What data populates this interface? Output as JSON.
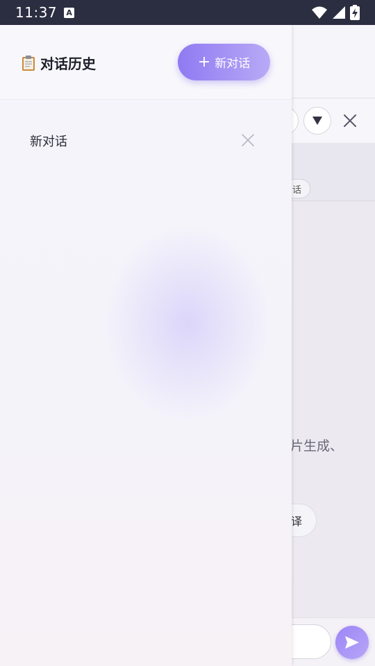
{
  "status_bar": {
    "time": "11:37",
    "notification_icon": "a-icon",
    "wifi_icon": "wifi-icon",
    "signal_icon": "signal-icon",
    "battery_icon": "battery-charging-icon"
  },
  "drawer": {
    "title_icon": "clipboard-icon",
    "title": "对话历史",
    "new_button": {
      "icon": "plus-icon",
      "label": "新对话"
    },
    "conversations": [
      {
        "title": "新对话",
        "delete_icon": "close-icon"
      }
    ]
  },
  "background": {
    "tag_chip_fragment": "话",
    "welcome_fragment": "片生成、",
    "pill_fragment": "译"
  },
  "colors": {
    "status_bar": "#2b2d40",
    "accent_start": "#8f7af2",
    "accent_end": "#b8aaf6",
    "title_text": "#1e1e2a"
  }
}
